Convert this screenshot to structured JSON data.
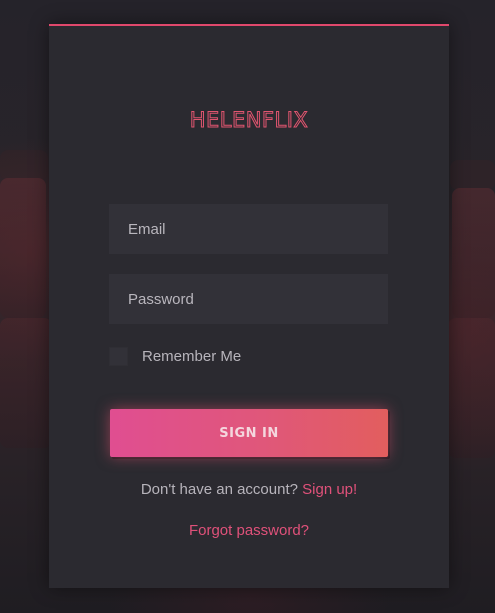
{
  "brand": {
    "logo_text": "HELENFLIX"
  },
  "form": {
    "email": {
      "placeholder": "Email",
      "value": ""
    },
    "password": {
      "placeholder": "Password",
      "value": ""
    },
    "remember_label": "Remember Me",
    "remember_checked": false,
    "submit_label": "SIGN IN"
  },
  "footer": {
    "signup_prompt": "Don't have an account?",
    "signup_link": "Sign up!",
    "forgot_link": "Forgot password?"
  },
  "colors": {
    "accent": "#e0486c",
    "card_bg": "#2b2a30",
    "field_bg": "#323138",
    "button_gradient_start": "#e04e91",
    "button_gradient_end": "#e25e5e"
  }
}
